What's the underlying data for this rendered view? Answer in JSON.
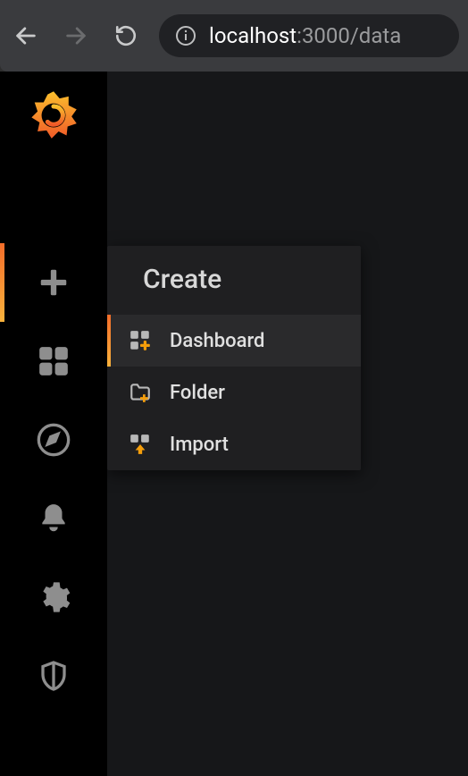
{
  "browser": {
    "url_host": "localhost",
    "url_port_path": ":3000/data"
  },
  "sidebar": {
    "items": [
      {
        "name": "create",
        "icon": "plus-icon",
        "active": true
      },
      {
        "name": "dashboards",
        "icon": "squares-icon",
        "active": false
      },
      {
        "name": "explore",
        "icon": "compass-icon",
        "active": false
      },
      {
        "name": "alerting",
        "icon": "bell-icon",
        "active": false
      },
      {
        "name": "settings",
        "icon": "gear-icon",
        "active": false
      },
      {
        "name": "admin",
        "icon": "shield-icon",
        "active": false
      }
    ]
  },
  "flyout": {
    "title": "Create",
    "items": [
      {
        "label": "Dashboard",
        "icon": "dashboard-add-icon",
        "active": true
      },
      {
        "label": "Folder",
        "icon": "folder-add-icon",
        "active": false
      },
      {
        "label": "Import",
        "icon": "import-icon",
        "active": false
      }
    ]
  }
}
